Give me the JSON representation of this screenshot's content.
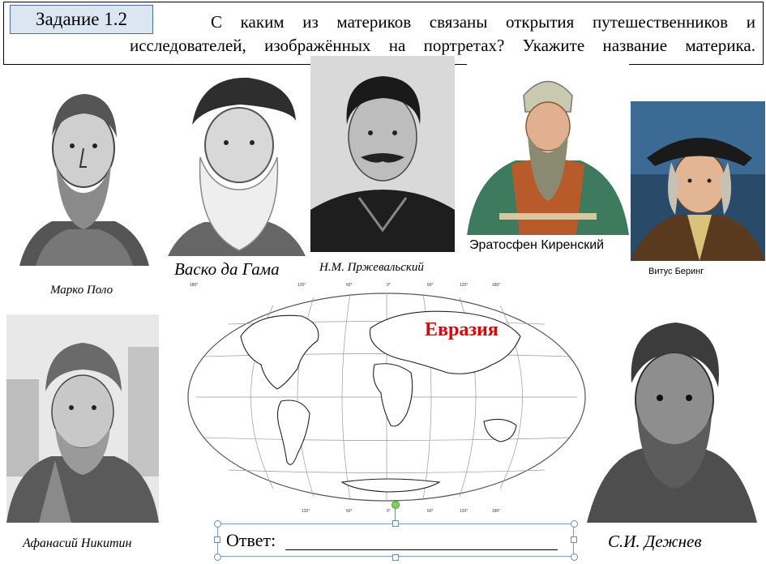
{
  "task": {
    "badge": "Задание 1.2",
    "question_line1": "С каким из материков связаны открытия путешественников и",
    "question_line2": "исследователей, изображённых на портретах?  Укажите название материка."
  },
  "portraits": [
    {
      "caption": "Марко Поло"
    },
    {
      "caption": "Васко да Гама"
    },
    {
      "caption": "Н.М. Пржевальский"
    },
    {
      "caption": "Эратосфен Киренский"
    },
    {
      "caption": "Витус Беринг"
    },
    {
      "caption": "Афанасий Никитин"
    },
    {
      "caption": "С.И. Дежнев"
    }
  ],
  "map": {
    "continent_label": "Евразия",
    "top_scale": [
      "180°",
      "120°",
      "60°",
      "0°",
      "60°",
      "120°",
      "180°"
    ],
    "bottom_scale": [
      "120°",
      "60°",
      "0°",
      "60°",
      "120°",
      "180°"
    ]
  },
  "answer": {
    "label": "Ответ:"
  },
  "colors": {
    "badge_fill": "#dce6f2",
    "badge_border": "#4f6fa0",
    "continent_label": "#e00000",
    "selection_handles": "#6a8cb3",
    "rotation_handle": "#7bd35a"
  }
}
